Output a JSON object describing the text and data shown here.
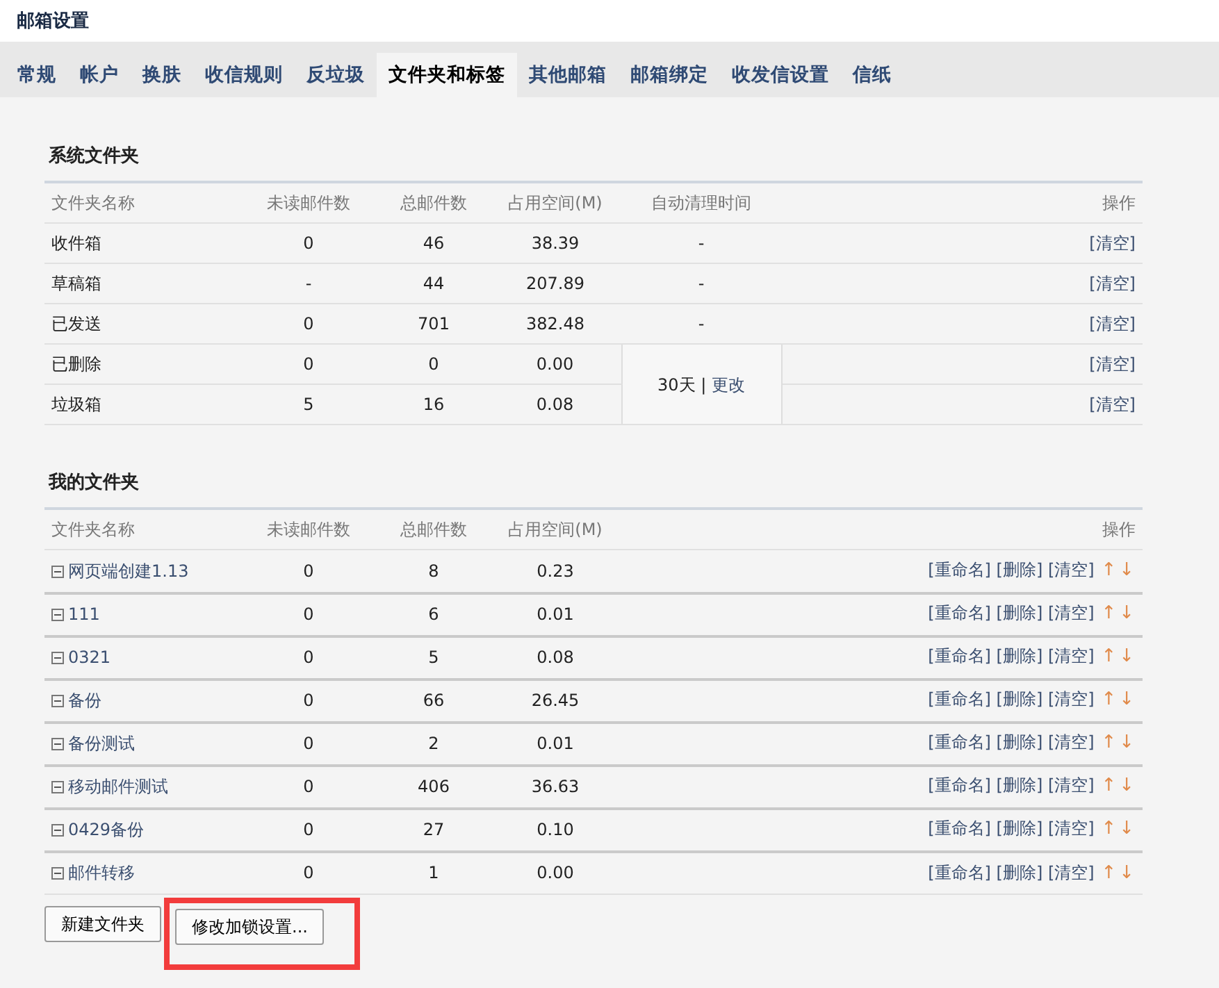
{
  "page_title": "邮箱设置",
  "tabs": [
    {
      "label": "常规",
      "selected": false
    },
    {
      "label": "帐户",
      "selected": false
    },
    {
      "label": "换肤",
      "selected": false
    },
    {
      "label": "收信规则",
      "selected": false
    },
    {
      "label": "反垃圾",
      "selected": false
    },
    {
      "label": "文件夹和标签",
      "selected": true
    },
    {
      "label": "其他邮箱",
      "selected": false
    },
    {
      "label": "邮箱绑定",
      "selected": false
    },
    {
      "label": "收发信设置",
      "selected": false
    },
    {
      "label": "信纸",
      "selected": false
    }
  ],
  "system_folders": {
    "title": "系统文件夹",
    "columns": [
      "文件夹名称",
      "未读邮件数",
      "总邮件数",
      "占用空间(M)",
      "自动清理时间",
      "操作"
    ],
    "rows": [
      {
        "name": "收件箱",
        "unread": "0",
        "total": "46",
        "size": "38.39",
        "auto_clean": "-",
        "action": "[清空]"
      },
      {
        "name": "草稿箱",
        "unread": "-",
        "total": "44",
        "size": "207.89",
        "auto_clean": "-",
        "action": "[清空]"
      },
      {
        "name": "已发送",
        "unread": "0",
        "total": "701",
        "size": "382.48",
        "auto_clean": "-",
        "action": "[清空]"
      },
      {
        "name": "已删除",
        "unread": "0",
        "total": "0",
        "size": "0.00",
        "action": "[清空]"
      },
      {
        "name": "垃圾箱",
        "unread": "5",
        "total": "16",
        "size": "0.08",
        "action": "[清空]"
      }
    ],
    "shared_clean": {
      "days": "30天",
      "separator": "|",
      "link": "更改"
    }
  },
  "my_folders": {
    "title": "我的文件夹",
    "columns": [
      "文件夹名称",
      "未读邮件数",
      "总邮件数",
      "占用空间(M)",
      "操作"
    ],
    "rows": [
      {
        "name": "网页端创建1.13",
        "expanded": true,
        "unread": "0",
        "total": "8",
        "size": "0.23",
        "actions": [
          "[重命名]",
          "[删除]",
          "[清空]"
        ],
        "up": "↑",
        "down": "↓"
      },
      {
        "name": "111",
        "expanded": true,
        "unread": "0",
        "total": "6",
        "size": "0.01",
        "actions": [
          "[重命名]",
          "[删除]",
          "[清空]"
        ],
        "up": "↑",
        "down": "↓"
      },
      {
        "name": "0321",
        "expanded": true,
        "unread": "0",
        "total": "5",
        "size": "0.08",
        "actions": [
          "[重命名]",
          "[删除]",
          "[清空]"
        ],
        "up": "↑",
        "down": "↓"
      },
      {
        "name": "备份",
        "expanded": true,
        "unread": "0",
        "total": "66",
        "size": "26.45",
        "actions": [
          "[重命名]",
          "[删除]",
          "[清空]"
        ],
        "up": "↑",
        "down": "↓"
      },
      {
        "name": "备份测试",
        "expanded": true,
        "unread": "0",
        "total": "2",
        "size": "0.01",
        "actions": [
          "[重命名]",
          "[删除]",
          "[清空]"
        ],
        "up": "↑",
        "down": "↓"
      },
      {
        "name": "移动邮件测试",
        "expanded": true,
        "unread": "0",
        "total": "406",
        "size": "36.63",
        "actions": [
          "[重命名]",
          "[删除]",
          "[清空]"
        ],
        "up": "↑",
        "down": "↓"
      },
      {
        "name": "0429备份",
        "expanded": true,
        "unread": "0",
        "total": "27",
        "size": "0.10",
        "actions": [
          "[重命名]",
          "[删除]",
          "[清空]"
        ],
        "up": "↑",
        "down": "↓"
      },
      {
        "name": "邮件转移",
        "expanded": true,
        "unread": "0",
        "total": "1",
        "size": "0.00",
        "actions": [
          "[重命名]",
          "[删除]",
          "[清空]"
        ],
        "up": "↑",
        "down": "↓"
      }
    ]
  },
  "buttons": [
    {
      "label": "新建文件夹",
      "highlighted": false
    },
    {
      "label": "修改加锁设置...",
      "highlighted": true
    }
  ]
}
